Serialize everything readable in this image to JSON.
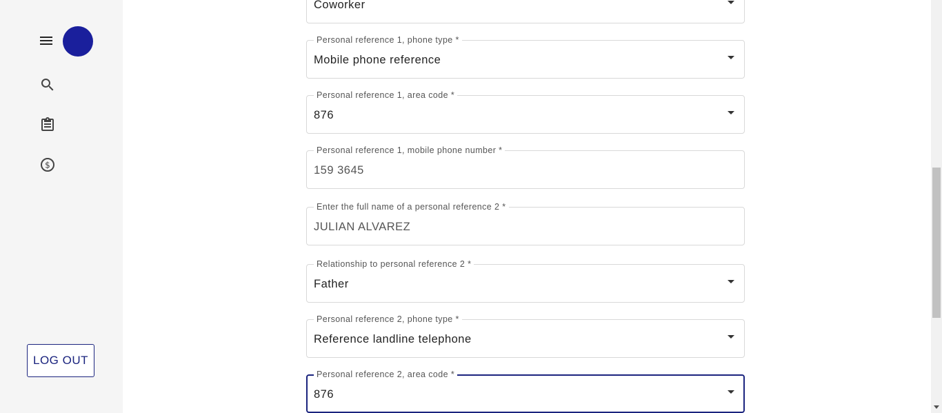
{
  "sidebar": {
    "menu_icon": "menu-icon",
    "nav_icons": [
      "search-icon",
      "clipboard-icon",
      "dollar-circle-icon"
    ],
    "logout_label": "LOG OUT",
    "avatar_color": "#1a1f9c"
  },
  "form": {
    "fields": [
      {
        "label": "",
        "value": "Coworker"
      },
      {
        "label": "Personal reference 1, phone type *",
        "value": "Mobile phone reference"
      },
      {
        "label": "Personal reference 1, area code *",
        "value": "876"
      },
      {
        "label": "Personal reference 1, mobile phone number *",
        "value": "159 3645"
      },
      {
        "label": "Enter the full name of a personal reference 2 *",
        "value": "JULIAN ALVAREZ"
      },
      {
        "label": "Relationship to personal reference 2 *",
        "value": "Father"
      },
      {
        "label": "Personal reference 2, phone type *",
        "value": "Reference landline telephone"
      },
      {
        "label": "Personal reference 2, area code *",
        "value": "876"
      }
    ]
  },
  "colors": {
    "accent": "#1a237e",
    "sidebar_bg": "#f5f5f5"
  }
}
